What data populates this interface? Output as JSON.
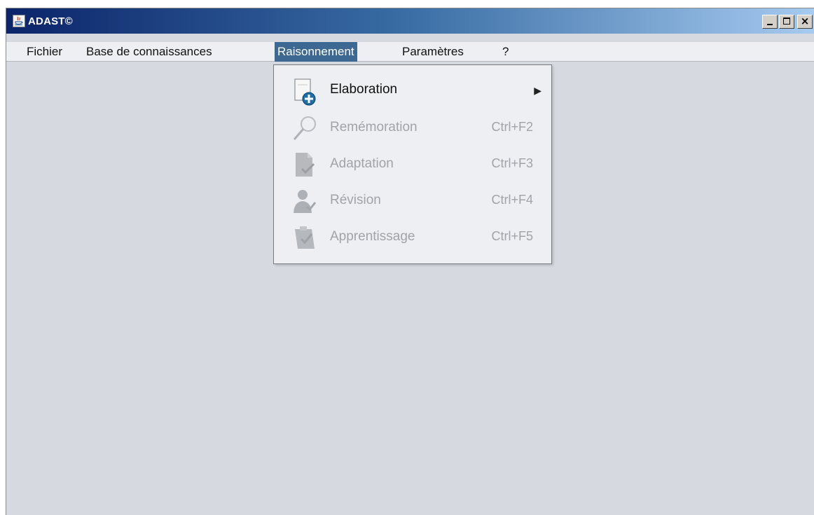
{
  "window": {
    "title": "ADAST©",
    "controls": {
      "minimize": "minimize",
      "maximize": "maximize",
      "close": "close"
    }
  },
  "menubar": {
    "items": [
      {
        "label": "Fichier",
        "active": false
      },
      {
        "label": "Base de connaissances",
        "active": false
      },
      {
        "label": "Raisonnement",
        "active": true
      },
      {
        "label": "Paramètres",
        "active": false
      },
      {
        "label": "?",
        "active": false
      }
    ]
  },
  "dropdown": {
    "items": [
      {
        "label": "Elaboration",
        "shortcut": "",
        "submenu": true,
        "enabled": true,
        "icon": "document-add-icon"
      },
      {
        "label": "Remémoration",
        "shortcut": "Ctrl+F2",
        "submenu": false,
        "enabled": false,
        "icon": "magnifier-icon"
      },
      {
        "label": "Adaptation",
        "shortcut": "Ctrl+F3",
        "submenu": false,
        "enabled": false,
        "icon": "document-check-icon"
      },
      {
        "label": "Révision",
        "shortcut": "Ctrl+F4",
        "submenu": false,
        "enabled": false,
        "icon": "user-check-icon"
      },
      {
        "label": "Apprentissage",
        "shortcut": "Ctrl+F5",
        "submenu": false,
        "enabled": false,
        "icon": "clipboard-check-icon"
      }
    ],
    "submenu_arrow": "▶"
  },
  "colors": {
    "title_gradient_start": "#0b246a",
    "title_gradient_end": "#a6caf0",
    "menu_active_bg": "#3d6891",
    "content_bg": "#d6d9df",
    "disabled_text": "#a1a3a8"
  }
}
